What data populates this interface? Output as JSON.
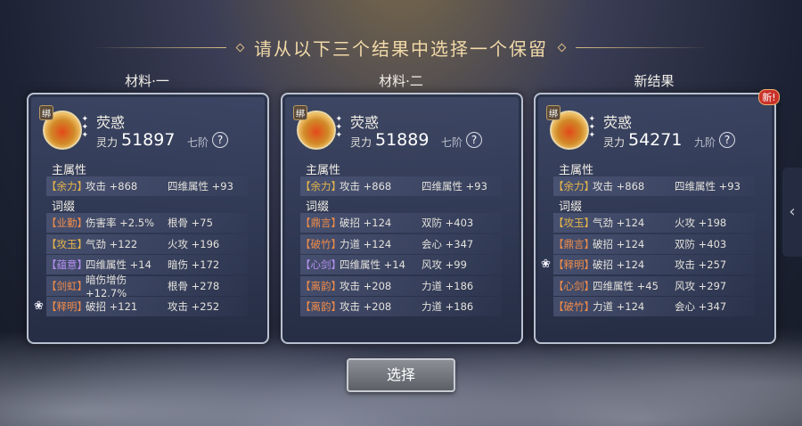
{
  "header": {
    "title": "请从以下三个结果中选择一个保留"
  },
  "columns": [
    {
      "label": "材料·一",
      "bind_badge": "绑",
      "name": "荧惑",
      "power_label": "灵力",
      "power": "51897",
      "tier": "七阶",
      "main_section": "主属性",
      "main_attrs": [
        {
          "tag": "【余力】",
          "color": "gold",
          "a1": "攻击 +868",
          "a2": "四维属性 +93",
          "lotus": false
        }
      ],
      "suffix_section": "词缀",
      "suffixes": [
        {
          "tag": "【业勤】",
          "color": "orange",
          "a1": "伤害率 +2.5%",
          "a2": "根骨 +75",
          "lotus": false
        },
        {
          "tag": "【攻玉】",
          "color": "gold",
          "a1": "气劲 +122",
          "a2": "火攻 +196",
          "lotus": false
        },
        {
          "tag": "【蕴意】",
          "color": "purple",
          "a1": "四维属性 +14",
          "a2": "暗伤 +172",
          "lotus": false
        },
        {
          "tag": "【剑虹】",
          "color": "orange",
          "a1": "暗伤增伤 +12.7%",
          "a2": "根骨 +278",
          "lotus": false
        },
        {
          "tag": "【释明】",
          "color": "orange",
          "a1": "破招 +121",
          "a2": "攻击 +252",
          "lotus": true
        }
      ],
      "is_new": false
    },
    {
      "label": "材料·二",
      "bind_badge": "绑",
      "name": "荧惑",
      "power_label": "灵力",
      "power": "51889",
      "tier": "七阶",
      "main_section": "主属性",
      "main_attrs": [
        {
          "tag": "【余力】",
          "color": "gold",
          "a1": "攻击 +868",
          "a2": "四维属性 +93",
          "lotus": false
        }
      ],
      "suffix_section": "词缀",
      "suffixes": [
        {
          "tag": "【鼎言】",
          "color": "orange",
          "a1": "破招 +124",
          "a2": "双防 +403",
          "lotus": false
        },
        {
          "tag": "【破竹】",
          "color": "orange",
          "a1": "力道 +124",
          "a2": "会心 +347",
          "lotus": false
        },
        {
          "tag": "【心剑】",
          "color": "purple",
          "a1": "四维属性 +14",
          "a2": "风攻 +99",
          "lotus": false
        },
        {
          "tag": "【离韵】",
          "color": "orange",
          "a1": "攻击 +208",
          "a2": "力道 +186",
          "lotus": false
        },
        {
          "tag": "【离韵】",
          "color": "orange",
          "a1": "攻击 +208",
          "a2": "力道 +186",
          "lotus": false
        }
      ],
      "is_new": false
    },
    {
      "label": "新结果",
      "bind_badge": "绑",
      "name": "荧惑",
      "power_label": "灵力",
      "power": "54271",
      "tier": "九阶",
      "main_section": "主属性",
      "main_attrs": [
        {
          "tag": "【余力】",
          "color": "gold",
          "a1": "攻击 +868",
          "a2": "四维属性 +93",
          "lotus": false
        }
      ],
      "suffix_section": "词缀",
      "suffixes": [
        {
          "tag": "【攻玉】",
          "color": "gold",
          "a1": "气劲 +124",
          "a2": "火攻 +198",
          "lotus": false
        },
        {
          "tag": "【鼎言】",
          "color": "orange",
          "a1": "破招 +124",
          "a2": "双防 +403",
          "lotus": false
        },
        {
          "tag": "【释明】",
          "color": "orange",
          "a1": "破招 +124",
          "a2": "攻击 +257",
          "lotus": true
        },
        {
          "tag": "【心剑】",
          "color": "orange",
          "a1": "四维属性 +45",
          "a2": "风攻 +297",
          "lotus": false
        },
        {
          "tag": "【破竹】",
          "color": "orange",
          "a1": "力道 +124",
          "a2": "会心 +347",
          "lotus": false
        }
      ],
      "is_new": true,
      "new_badge": "新!"
    }
  ],
  "help_glyph": "?",
  "select_button": "选择",
  "side_arrow": "‹"
}
